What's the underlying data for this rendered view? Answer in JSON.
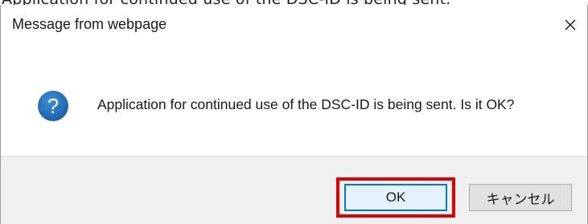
{
  "background": {
    "caption": "Application for continued use of the DSC-ID is being sent."
  },
  "dialog": {
    "title": "Message from webpage",
    "close_icon": "close-icon",
    "icon": "question-icon",
    "message": "Application for continued use of the DSC-ID is being sent.  Is it OK?",
    "buttons": {
      "ok_label": "OK",
      "cancel_label": "キャンセル"
    },
    "highlighted_button": "OK"
  },
  "colors": {
    "accent_blue": "#0078d7",
    "highlight_red": "#e00000",
    "footer_bg": "#f0f0f0",
    "icon_blue": "#1f6fb5"
  }
}
